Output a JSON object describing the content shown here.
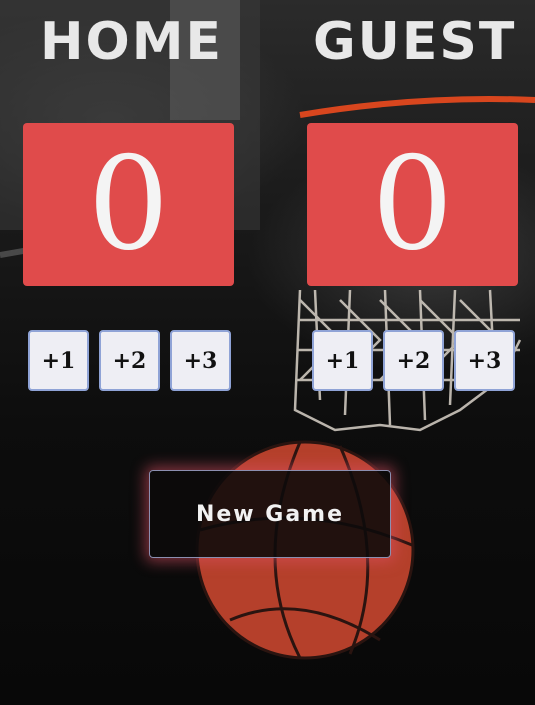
{
  "home": {
    "title": "HOME",
    "score": "0",
    "buttons": [
      "+1",
      "+2",
      "+3"
    ]
  },
  "guest": {
    "title": "GUEST",
    "score": "0",
    "buttons": [
      "+1",
      "+2",
      "+3"
    ]
  },
  "controls": {
    "new_game_label": "New Game"
  },
  "colors": {
    "score_box": "#e04b4b",
    "score_text": "#f4f4f4",
    "title_text": "#e8e8e8",
    "button_bg": "#eeeef4",
    "button_border": "#8fa3d6",
    "new_game_glow": "#dc5064"
  }
}
